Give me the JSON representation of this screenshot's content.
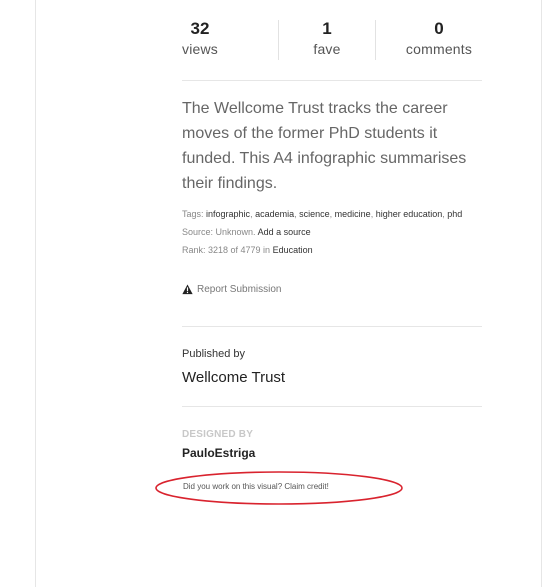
{
  "stats": {
    "views": {
      "count": "32",
      "label": "views"
    },
    "faves": {
      "count": "1",
      "label": "fave"
    },
    "comments": {
      "count": "0",
      "label": "comments"
    }
  },
  "description": "The Wellcome Trust tracks the career moves of the former PhD students it funded. This A4 infographic summarises their findings.",
  "meta": {
    "tags_label": "Tags:",
    "tags": [
      "infographic",
      "academia",
      "science",
      "medicine",
      "higher education",
      "phd"
    ],
    "source_label": "Source: Unknown.",
    "add_source": "Add a source",
    "rank_text": "Rank: 3218 of 4779 in",
    "rank_category": "Education"
  },
  "report": {
    "label": "Report Submission",
    "icon": "warning-icon"
  },
  "published": {
    "label": "Published by",
    "name": "Wellcome Trust"
  },
  "designed": {
    "label": "DESIGNED BY",
    "name": "PauloEstriga"
  },
  "claim": {
    "text": "Did you work on this visual? Claim credit!",
    "annotation_color": "#d9232e"
  }
}
